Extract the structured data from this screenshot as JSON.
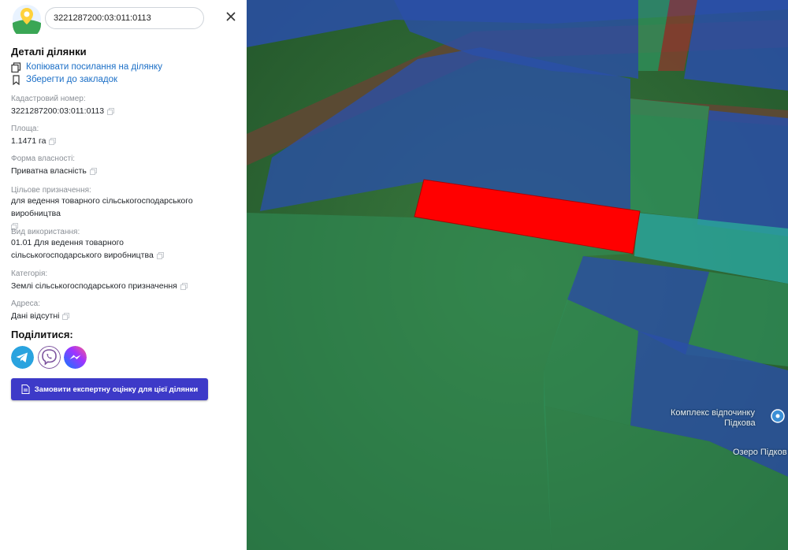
{
  "search": {
    "value": "3221287200:03:011:0113"
  },
  "details": {
    "title": "Деталі ділянки",
    "copy_link": "Копіювати посилання на ділянку",
    "bookmark": "Зберегти до закладок"
  },
  "fields": {
    "cadastral_label": "Кадастровий номер:",
    "cadastral_value": "3221287200:03:011:0113",
    "area_label": "Площа:",
    "area_value": "1.1471 га",
    "ownership_label": "Форма власності:",
    "ownership_value": "Приватна власність",
    "purpose_label": "Цільове призначення:",
    "purpose_value": "для ведення товарного сільськогосподарського виробництва",
    "usage_label": "Вид використання:",
    "usage_value": "01.01 Для ведення товарного сільськогосподарського виробництва",
    "category_label": "Категорія:",
    "category_value": "Землі сільськогосподарського призначення",
    "address_label": "Адреса:",
    "address_value": "Дані відсутні"
  },
  "share": {
    "title": "Поділитися:",
    "icons": [
      "telegram-icon",
      "viber-icon",
      "messenger-icon"
    ]
  },
  "order_button": "Замовити експертну оцінку для цієї ділянки",
  "map": {
    "labels": {
      "complex_line1": "Комплекс відпочинку",
      "complex_line2": "Підкова",
      "lake": "Озеро Підков"
    },
    "colors": {
      "selected_parcel": "#ff0000",
      "blue_parcel": "#2a4fa8",
      "green_parcel": "#2f8f5a",
      "teal_parcel": "#2aa39a",
      "accent": "#3d3ac8",
      "link": "#1b6fc7"
    }
  }
}
